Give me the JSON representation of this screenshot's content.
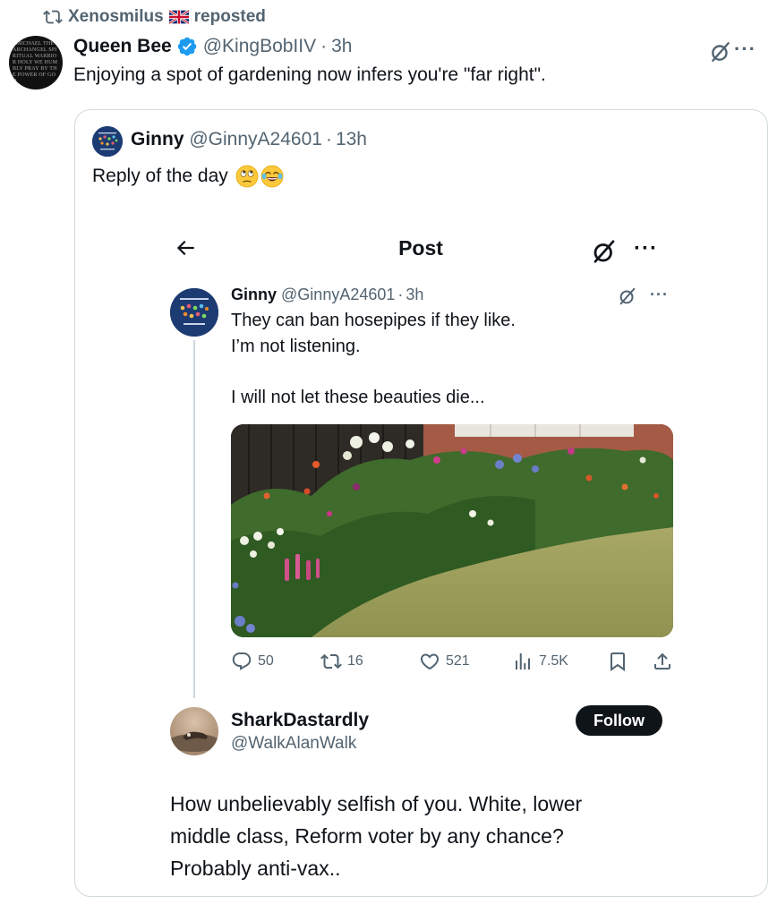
{
  "repost": {
    "user": "Xenosmilus",
    "label": "reposted"
  },
  "main_post": {
    "avatar_text": "I MICHAEL THE ARCHANGEL SPIRITUAL WARRIOR HOLY WE HUMBLY PRAY BY THE POWER OF GOD",
    "name": "Queen Bee",
    "handle": "@KingBobIIV",
    "separator": "·",
    "time": "3h",
    "text": "Enjoying a spot of gardening now infers you're \"far right\".",
    "more": "···"
  },
  "quoted_post": {
    "name": "Ginny",
    "handle": "@GinnyA24601",
    "separator": "·",
    "time": "13h",
    "text": "Reply of the day"
  },
  "screenshot": {
    "header_title": "Post",
    "more": "···",
    "inner_post": {
      "name": "Ginny",
      "handle": "@GinnyA24601",
      "separator": "·",
      "time": "3h",
      "more": "···",
      "line1": "They can ban hosepipes if they like.",
      "line2": "I’m not listening.",
      "line3": "I will not let these beauties die..."
    },
    "actions": {
      "replies": "50",
      "reposts": "16",
      "likes": "521",
      "views": "7.5K"
    },
    "reply": {
      "name": "SharkDastardly",
      "handle": "@WalkAlanWalk",
      "follow_label": "Follow",
      "line1": "How unbelievably selfish of you. White, lower",
      "line2": "middle class, Reform voter by any chance?",
      "line3": "Probably anti-vax.."
    }
  },
  "colors": {
    "text_primary": "#0f1419",
    "text_secondary": "#536471",
    "verified_blue": "#1d9bf0",
    "border": "#cfd9de"
  }
}
